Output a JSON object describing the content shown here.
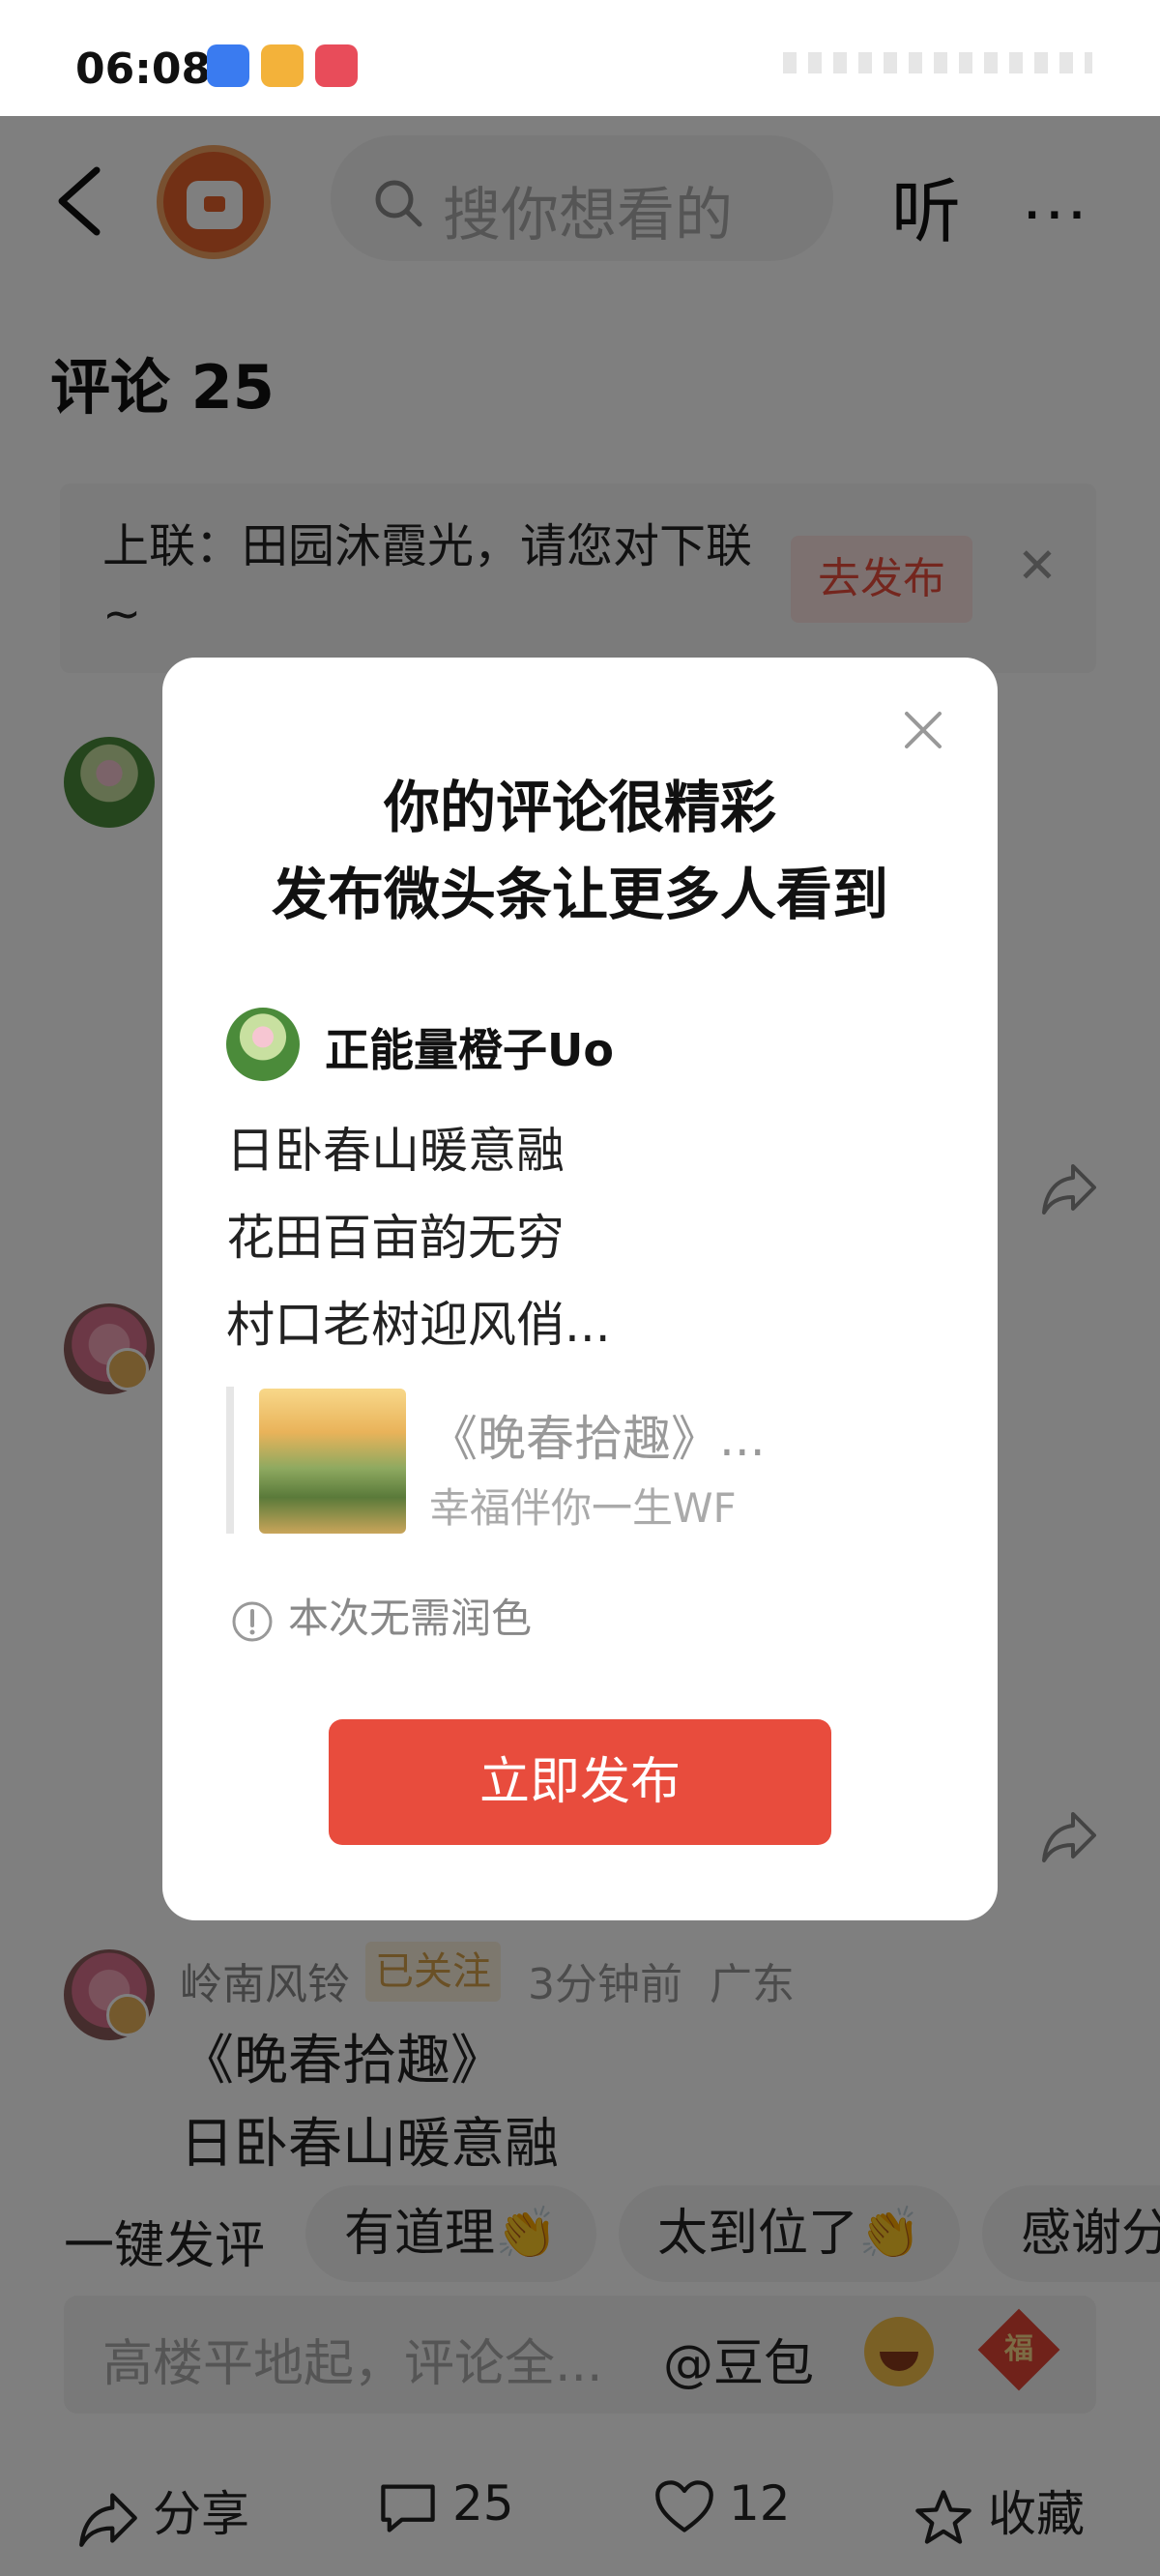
{
  "status_bar": {
    "time": "06:08"
  },
  "topbar": {
    "search_placeholder": "搜你想看的",
    "listen_label": "听",
    "more_label": "···"
  },
  "comments": {
    "title": "评论 25",
    "couplet_prompt": "上联：田园沐霞光，请您对下联 ~",
    "couplet_button": "去发布",
    "third": {
      "username": "岭南风铃",
      "follow_tag": "已关注",
      "time": "3分钟前",
      "location": "广东",
      "lines": [
        "《晚春拾趣》",
        "日卧春山暖意融"
      ]
    }
  },
  "quick_comment": {
    "label": "一键发评",
    "chips": [
      "有道理👏",
      "太到位了👏",
      "感谢分"
    ]
  },
  "input": {
    "placeholder": "高楼平地起，评论全...",
    "mention": "@豆包",
    "fu_char": "福"
  },
  "bottom_bar": {
    "share": "分享",
    "comments": "25",
    "likes": "12",
    "favorite": "收藏"
  },
  "modal": {
    "title_line1": "你的评论很精彩",
    "title_line2": "发布微头条让更多人看到",
    "username": "正能量橙子Uo",
    "lines": [
      "日卧春山暖意融",
      "花田百亩韵无穷",
      "村口老树迎风俏..."
    ],
    "quote_title": "《晚春拾趣》...",
    "quote_author": "幸福伴你一生WF",
    "note": "本次无需润色",
    "publish_button": "立即发布"
  },
  "colors": {
    "accent": "#e84c3d",
    "follow_tag": "#d4a04a"
  }
}
